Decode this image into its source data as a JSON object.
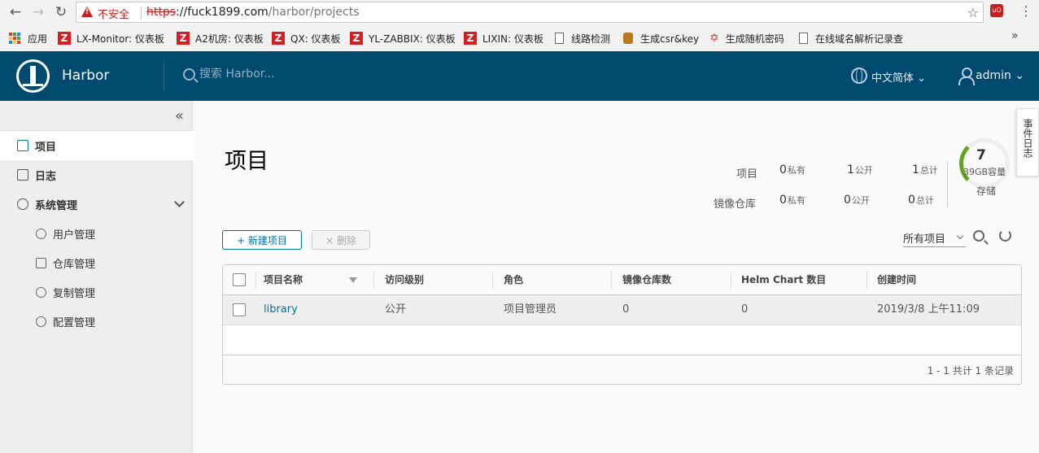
{
  "browser": {
    "warning": "不安全",
    "url_proto": "https",
    "url_host": "://fuck1899.com",
    "url_path": "/harbor/projects",
    "bookmarks": [
      {
        "label": "应用"
      },
      {
        "label": "LX-Monitor: 仪表板"
      },
      {
        "label": "A2机房: 仪表板"
      },
      {
        "label": "QX: 仪表板"
      },
      {
        "label": "YL-ZABBIX: 仪表板"
      },
      {
        "label": "LIXIN: 仪表板"
      },
      {
        "label": "线路检测"
      },
      {
        "label": "生成csr&key"
      },
      {
        "label": "生成随机密码"
      },
      {
        "label": "在线域名解析记录查"
      }
    ],
    "more": "»"
  },
  "header": {
    "brand": "Harbor",
    "search_placeholder": "搜索 Harbor...",
    "language": "中文简体",
    "user": "admin"
  },
  "sidebar": {
    "collapse": "«",
    "items": [
      {
        "label": "项目"
      },
      {
        "label": "日志"
      },
      {
        "label": "系统管理"
      }
    ],
    "subitems": [
      {
        "label": "用户管理"
      },
      {
        "label": "仓库管理"
      },
      {
        "label": "复制管理"
      },
      {
        "label": "配置管理"
      }
    ]
  },
  "main": {
    "title": "项目",
    "stats": {
      "projects_label": "项目",
      "repos_label": "镜像仓库",
      "projects": {
        "private": "0",
        "public": "1",
        "total": "1"
      },
      "repos": {
        "private": "0",
        "public": "0",
        "total": "0"
      },
      "private_label": "私有",
      "public_label": "公开",
      "total_label": "总计"
    },
    "storage": {
      "count": "7",
      "capacity": "39GB容量",
      "label": "存储",
      "used_fraction": 0.18
    },
    "event_log": "事件日志",
    "new_project": "+ 新建项目",
    "delete": "× 删除",
    "filter": "所有项目",
    "table": {
      "headers": [
        "项目名称",
        "访问级别",
        "角色",
        "镜像仓库数",
        "Helm Chart 数目",
        "创建时间"
      ],
      "rows": [
        [
          "library",
          "公开",
          "项目管理员",
          "0",
          "0",
          "2019/3/8 上午11:09"
        ]
      ],
      "footer": "1 - 1 共计 1 条记录"
    }
  }
}
